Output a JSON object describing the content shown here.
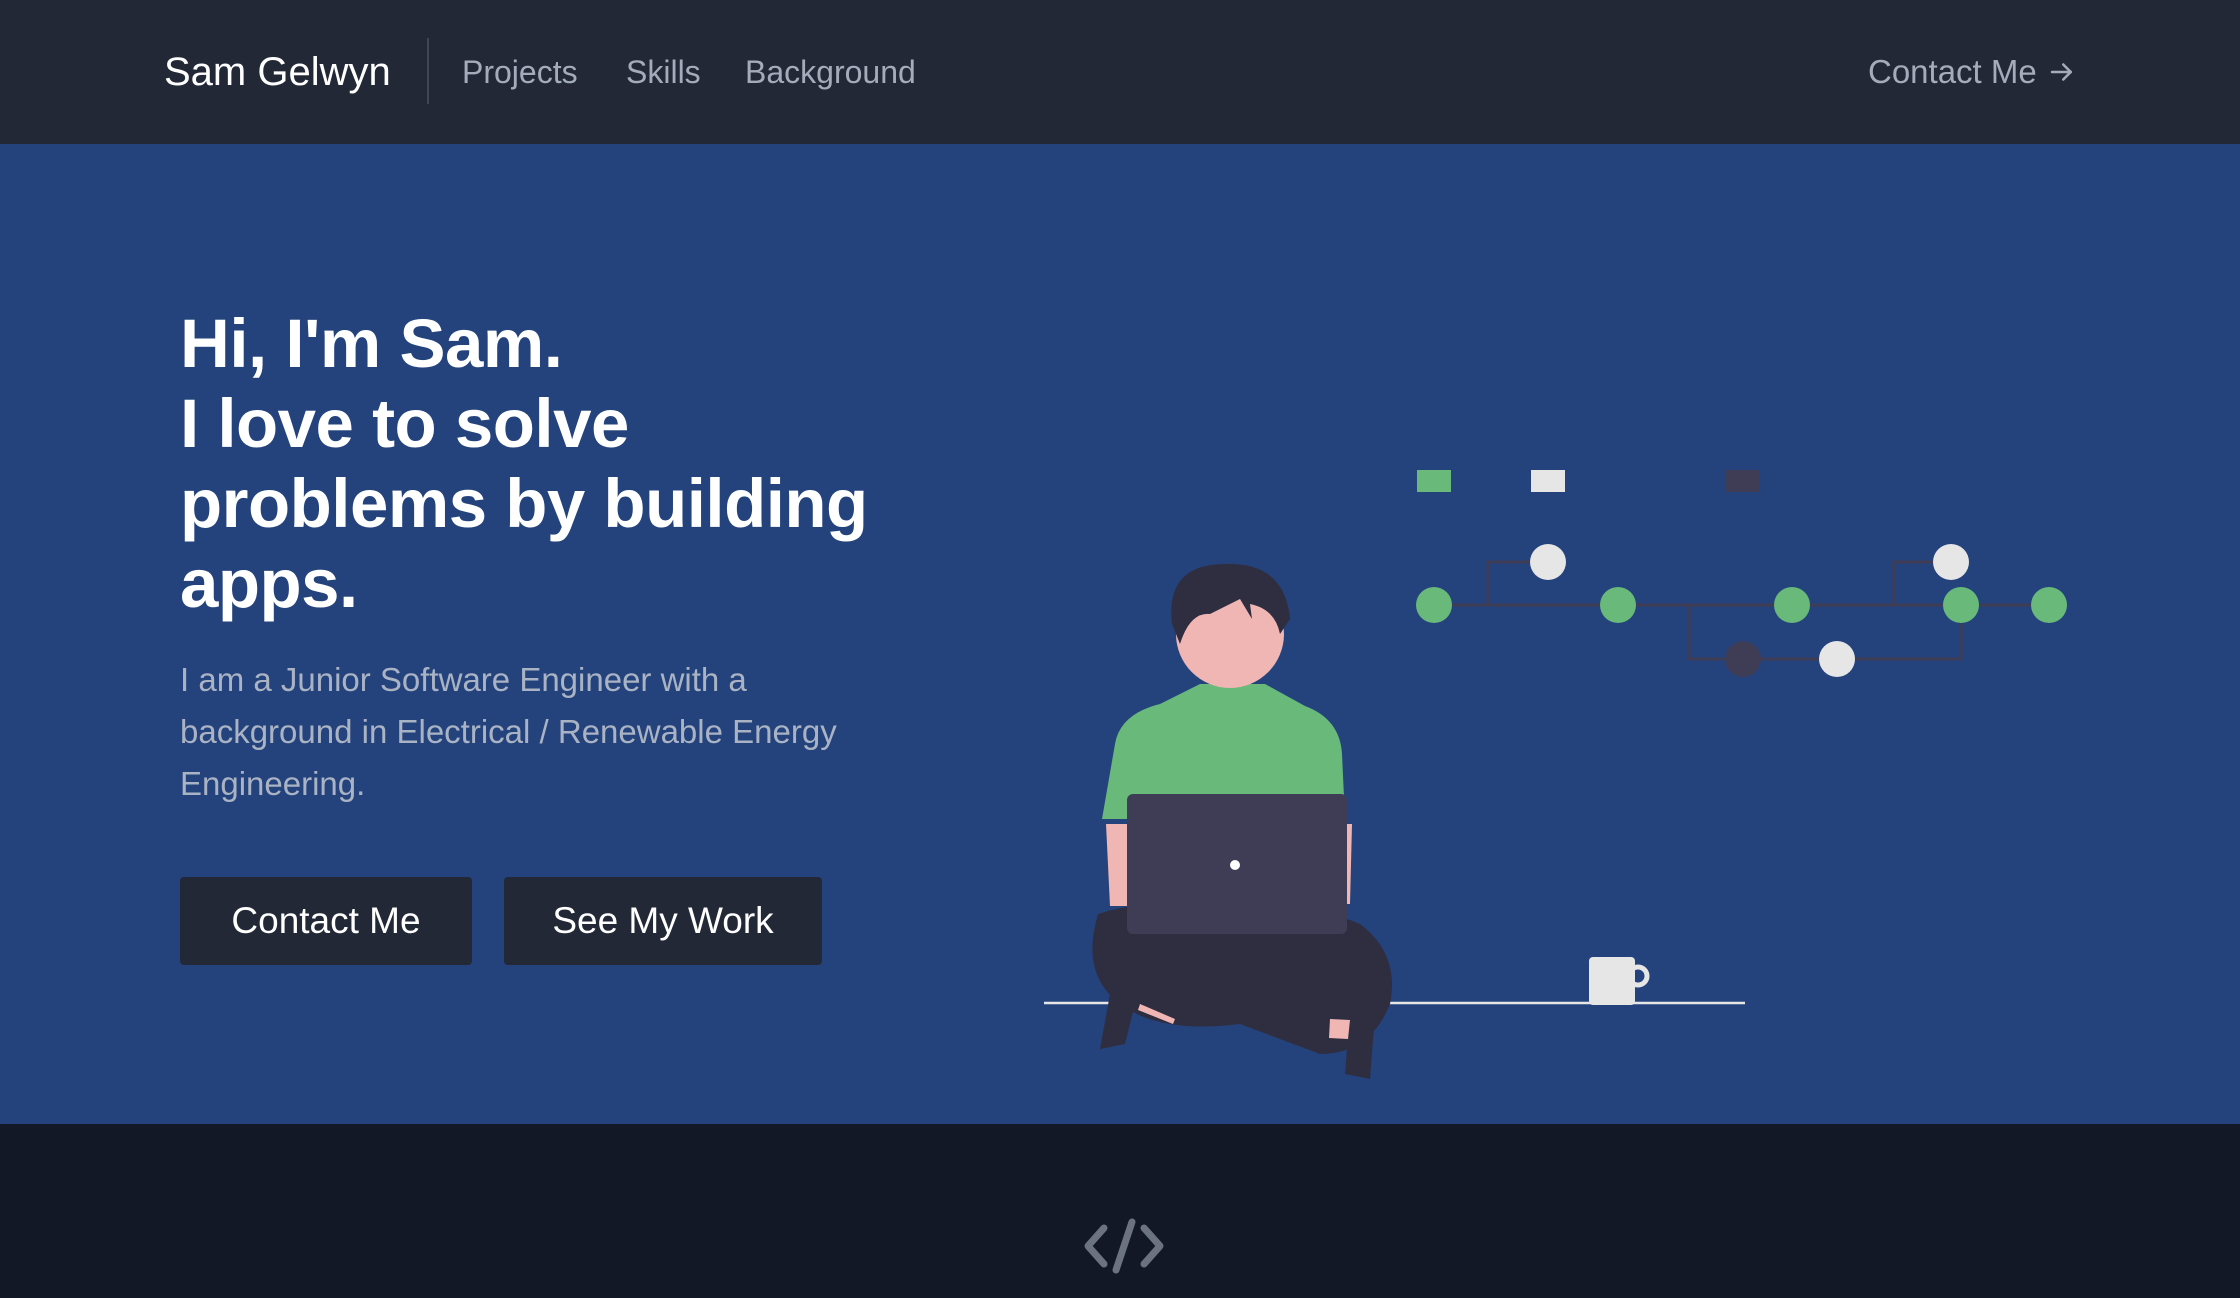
{
  "header": {
    "brand": "Sam Gelwyn",
    "nav": [
      "Projects",
      "Skills",
      "Background"
    ],
    "contact_label": "Contact Me"
  },
  "hero": {
    "headline": [
      "Hi, I'm Sam.",
      "I love to solve",
      "problems by building",
      "apps."
    ],
    "intro": [
      "I am a Junior Software Engineer with a",
      "background in Electrical / Renewable Energy",
      "Engineering."
    ],
    "contact_button": "Contact Me",
    "work_button": "See My Work"
  },
  "colors": {
    "header_bg": "#222836",
    "hero_bg": "#24437c",
    "footer_bg": "#131827",
    "accent_green": "#68b97a"
  },
  "icons": {
    "header_cta": "arrow-right-icon",
    "section": "code-icon"
  }
}
